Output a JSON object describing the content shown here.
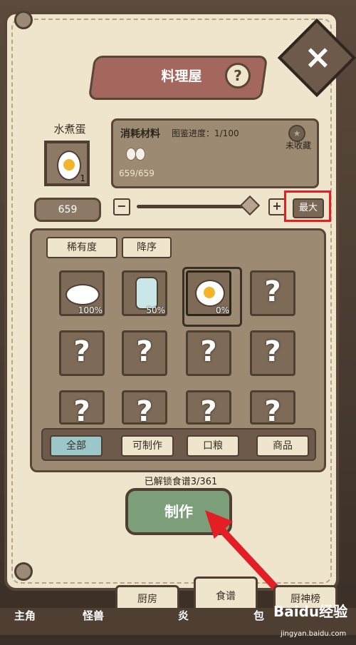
{
  "header": {
    "title": "料理屋",
    "help_icon": "?"
  },
  "item": {
    "name": "水煮蛋",
    "count": "1"
  },
  "materials": {
    "title": "消耗材料",
    "progress": "图鉴进度：1/100",
    "amount": "659/659",
    "uncollected": "未收藏"
  },
  "quantity": {
    "value": "659",
    "minus": "−",
    "plus": "+",
    "max": "最大",
    "slider_level": 1
  },
  "sort": {
    "rarity": "稀有度",
    "order": "降序"
  },
  "recipes": [
    {
      "pct": "100%",
      "type": "dish"
    },
    {
      "pct": "50%",
      "type": "jar"
    },
    {
      "pct": "0%",
      "type": "egg",
      "selected": true
    },
    {
      "pct": "",
      "type": "unknown"
    }
  ],
  "unknown_mark": "?",
  "filters": {
    "all": "全部",
    "craftable": "可制作",
    "ration": "口粮",
    "goods": "商品"
  },
  "unlocked": "已解锁食谱3/361",
  "make": "制作",
  "bottom_tabs": {
    "kitchen": "厨房",
    "recipes": "食谱",
    "chef": "厨神榜"
  },
  "nav": {
    "home": "主角",
    "monster": "怪兽",
    "stove": "炎",
    "bag": "包"
  },
  "watermark": {
    "brand": "Baidu经验",
    "url": "jingyan.baidu.com"
  },
  "colors": {
    "accent": "#e31e24",
    "panel": "#efe4cc",
    "make_button": "#7c9f79"
  }
}
